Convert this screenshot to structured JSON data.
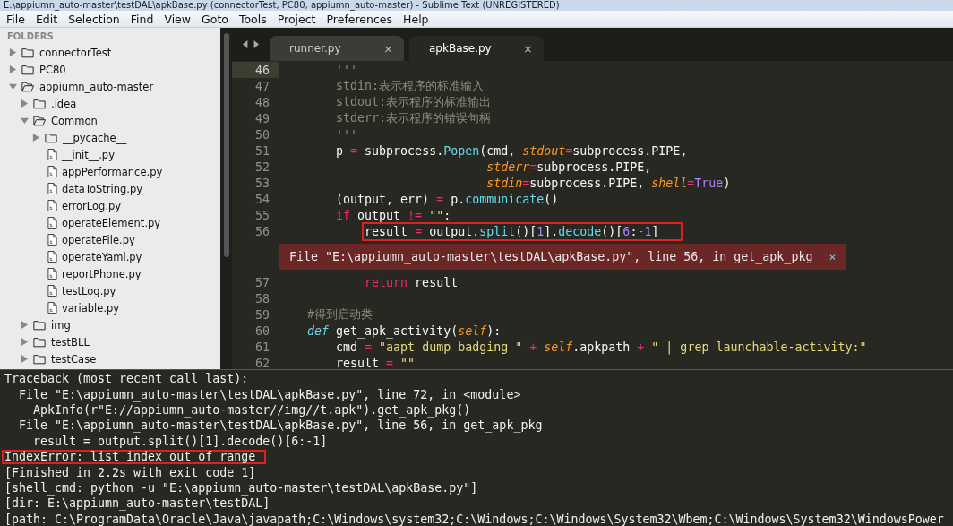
{
  "window": {
    "title": "E:\\appiumn_auto-master\\testDAL\\apkBase.py (connectorTest, PC80, appiumn_auto-master) - Sublime Text (UNREGISTERED)"
  },
  "menu": [
    "File",
    "Edit",
    "Selection",
    "Find",
    "View",
    "Goto",
    "Tools",
    "Project",
    "Preferences",
    "Help"
  ],
  "sidebar": {
    "heading": "FOLDERS",
    "items": [
      {
        "label": "connectorTest",
        "kind": "folder",
        "expanded": false
      },
      {
        "label": "PC80",
        "kind": "folder",
        "expanded": false
      },
      {
        "label": "appiumn_auto-master",
        "kind": "folder",
        "expanded": true,
        "children": [
          {
            "label": ".idea",
            "kind": "folder",
            "expanded": false
          },
          {
            "label": "Common",
            "kind": "folder",
            "expanded": true,
            "children": [
              {
                "label": "__pycache__",
                "kind": "folder",
                "expanded": false
              },
              {
                "label": "__init__.py",
                "kind": "file"
              },
              {
                "label": "appPerformance.py",
                "kind": "file"
              },
              {
                "label": "dataToString.py",
                "kind": "file"
              },
              {
                "label": "errorLog.py",
                "kind": "file"
              },
              {
                "label": "operateElement.py",
                "kind": "file"
              },
              {
                "label": "operateFile.py",
                "kind": "file"
              },
              {
                "label": "operateYaml.py",
                "kind": "file"
              },
              {
                "label": "reportPhone.py",
                "kind": "file"
              },
              {
                "label": "testLog.py",
                "kind": "file"
              },
              {
                "label": "variable.py",
                "kind": "file"
              }
            ]
          },
          {
            "label": "img",
            "kind": "folder",
            "expanded": false
          },
          {
            "label": "testBLL",
            "kind": "folder",
            "expanded": false
          },
          {
            "label": "testCase",
            "kind": "folder",
            "expanded": false
          }
        ]
      }
    ]
  },
  "tabs": [
    {
      "label": "runner.py",
      "close": "×",
      "selected": false
    },
    {
      "label": "apkBase.py",
      "close": "×",
      "selected": true
    }
  ],
  "code": [
    {
      "number": "46",
      "current": true,
      "boxed": false,
      "tokens": [
        {
          "text": "        '''",
          "kind": "doc"
        }
      ]
    },
    {
      "number": "47",
      "current": false,
      "boxed": false,
      "tokens": [
        {
          "text": "        stdin:表示程序的标准输入",
          "kind": "doc"
        }
      ]
    },
    {
      "number": "48",
      "current": false,
      "boxed": false,
      "tokens": [
        {
          "text": "        stdout:表示程序的标准输出",
          "kind": "doc"
        }
      ]
    },
    {
      "number": "49",
      "current": false,
      "boxed": false,
      "tokens": [
        {
          "text": "        stderr:表示程序的错误句柄",
          "kind": "doc"
        }
      ]
    },
    {
      "number": "50",
      "current": false,
      "boxed": false,
      "tokens": [
        {
          "text": "        '''",
          "kind": "doc"
        }
      ]
    },
    {
      "number": "51",
      "current": false,
      "boxed": false,
      "tokens": [
        {
          "text": "        p ",
          "kind": "plain"
        },
        {
          "text": "=",
          "kind": "op"
        },
        {
          "text": " subprocess.",
          "kind": "plain"
        },
        {
          "text": "Popen",
          "kind": "call"
        },
        {
          "text": "(cmd, ",
          "kind": "plain"
        },
        {
          "text": "stdout",
          "kind": "arg"
        },
        {
          "text": "=",
          "kind": "op"
        },
        {
          "text": "subprocess.PIPE,",
          "kind": "plain"
        }
      ]
    },
    {
      "number": "52",
      "current": false,
      "boxed": false,
      "tokens": [
        {
          "text": "                             stderr",
          "kind": "arg"
        },
        {
          "text": "=",
          "kind": "op"
        },
        {
          "text": "subprocess.PIPE,",
          "kind": "plain"
        }
      ]
    },
    {
      "number": "53",
      "current": false,
      "boxed": false,
      "tokens": [
        {
          "text": "                             stdin",
          "kind": "arg"
        },
        {
          "text": "=",
          "kind": "op"
        },
        {
          "text": "subprocess.PIPE, ",
          "kind": "plain"
        },
        {
          "text": "shell",
          "kind": "arg"
        },
        {
          "text": "=",
          "kind": "op"
        },
        {
          "text": "True",
          "kind": "num"
        },
        {
          "text": ")",
          "kind": "plain"
        }
      ]
    },
    {
      "number": "54",
      "current": false,
      "boxed": false,
      "tokens": [
        {
          "text": "        (output, err) ",
          "kind": "plain"
        },
        {
          "text": "=",
          "kind": "op"
        },
        {
          "text": " p.",
          "kind": "plain"
        },
        {
          "text": "communicate",
          "kind": "call"
        },
        {
          "text": "()",
          "kind": "plain"
        }
      ]
    },
    {
      "number": "55",
      "current": false,
      "boxed": false,
      "tokens": [
        {
          "text": "        if",
          "kind": "op"
        },
        {
          "text": " output ",
          "kind": "plain"
        },
        {
          "text": "!=",
          "kind": "op"
        },
        {
          "text": " \"\"",
          "kind": "str"
        },
        {
          "text": ":",
          "kind": "plain"
        }
      ]
    },
    {
      "number": "56",
      "current": false,
      "boxed": true,
      "tokens": [
        {
          "text": "            result ",
          "kind": "plain"
        },
        {
          "text": "=",
          "kind": "op"
        },
        {
          "text": " output.",
          "kind": "plain"
        },
        {
          "text": "split",
          "kind": "call"
        },
        {
          "text": "()[",
          "kind": "plain"
        },
        {
          "text": "1",
          "kind": "num"
        },
        {
          "text": "].",
          "kind": "plain"
        },
        {
          "text": "decode",
          "kind": "call"
        },
        {
          "text": "()[",
          "kind": "plain"
        },
        {
          "text": "6",
          "kind": "num"
        },
        {
          "text": ":",
          "kind": "plain"
        },
        {
          "text": "-1",
          "kind": "num"
        },
        {
          "text": "]",
          "kind": "plain"
        }
      ],
      "annotation": {
        "text": "File \"E:\\appiumn_auto-master\\testDAL\\apkBase.py\", line 56, in get_apk_pkg",
        "close": "×"
      }
    },
    {
      "number": "57",
      "current": false,
      "boxed": false,
      "tokens": [
        {
          "text": "            return",
          "kind": "op"
        },
        {
          "text": " result",
          "kind": "plain"
        }
      ]
    },
    {
      "number": "58",
      "current": false,
      "boxed": false
    },
    {
      "number": "59",
      "current": false,
      "boxed": false,
      "tokens": [
        {
          "text": "    #得到启动类",
          "kind": "doc"
        }
      ]
    },
    {
      "number": "60",
      "current": false,
      "boxed": false,
      "tokens": [
        {
          "text": "    def",
          "kind": "def"
        },
        {
          "text": " get_apk_activity(",
          "kind": "plain"
        },
        {
          "text": "self",
          "kind": "arg"
        },
        {
          "text": "):",
          "kind": "plain"
        }
      ]
    },
    {
      "number": "61",
      "current": false,
      "boxed": false,
      "tokens": [
        {
          "text": "        cmd ",
          "kind": "plain"
        },
        {
          "text": "=",
          "kind": "op"
        },
        {
          "text": " \"aapt dump badging \"",
          "kind": "str"
        },
        {
          "text": " +",
          "kind": "op"
        },
        {
          "text": " self",
          "kind": "arg"
        },
        {
          "text": ".apkpath ",
          "kind": "plain"
        },
        {
          "text": "+",
          "kind": "op"
        },
        {
          "text": " \" | grep launchable-activity:\"",
          "kind": "str"
        }
      ]
    },
    {
      "number": "62",
      "current": false,
      "boxed": false,
      "tokens": [
        {
          "text": "        result ",
          "kind": "plain"
        },
        {
          "text": "=",
          "kind": "op"
        },
        {
          "text": " \"\"",
          "kind": "str"
        }
      ]
    }
  ],
  "console": [
    {
      "text": "Traceback (most recent call last):",
      "boxed": false
    },
    {
      "text": "  File \"E:\\appiumn_auto-master\\testDAL\\apkBase.py\", line 72, in <module>",
      "boxed": false
    },
    {
      "text": "    ApkInfo(r\"E://appiumn_auto-master//img//t.apk\").get_apk_pkg()",
      "boxed": false
    },
    {
      "text": "  File \"E:\\appiumn_auto-master\\testDAL\\apkBase.py\", line 56, in get_apk_pkg",
      "boxed": false
    },
    {
      "text": "    result = output.split()[1].decode()[6:-1]",
      "boxed": false
    },
    {
      "text": "IndexError: list index out of range",
      "boxed": true
    },
    {
      "text": "[Finished in 2.2s with exit code 1]",
      "boxed": false
    },
    {
      "text": "[shell_cmd: python -u \"E:\\appiumn_auto-master\\testDAL\\apkBase.py\"]",
      "boxed": false
    },
    {
      "text": "[dir: E:\\appiumn_auto-master\\testDAL]",
      "boxed": false
    },
    {
      "text": "[path: C:\\ProgramData\\Oracle\\Java\\javapath;C:\\Windows\\system32;C:\\Windows;C:\\Windows\\System32\\Wbem;C:\\Windows\\System32\\WindowsPower",
      "boxed": false
    }
  ]
}
